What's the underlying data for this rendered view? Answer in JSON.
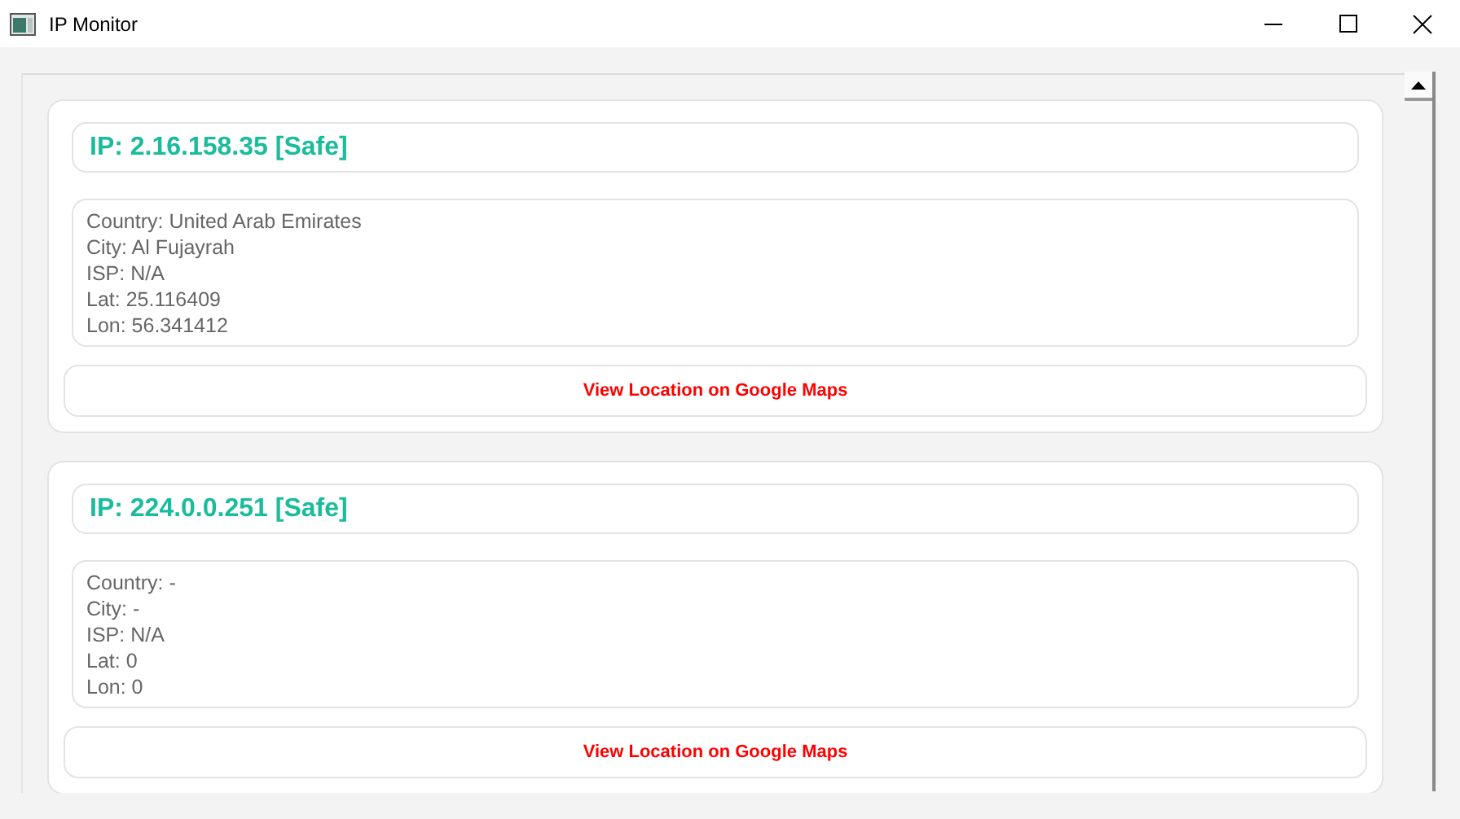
{
  "window": {
    "title": "IP Monitor"
  },
  "entries": [
    {
      "title": "IP: 2.16.158.35 [Safe]",
      "details": [
        "Country: United Arab Emirates",
        "City: Al Fujayrah",
        "ISP: N/A",
        "Lat: 25.116409",
        "Lon: 56.341412"
      ],
      "button": "View Location on Google Maps"
    },
    {
      "title": "IP: 224.0.0.251 [Safe]",
      "details": [
        "Country: -",
        "City: -",
        "ISP: N/A",
        "Lat: 0",
        "Lon: 0"
      ],
      "button": "View Location on Google Maps"
    }
  ]
}
